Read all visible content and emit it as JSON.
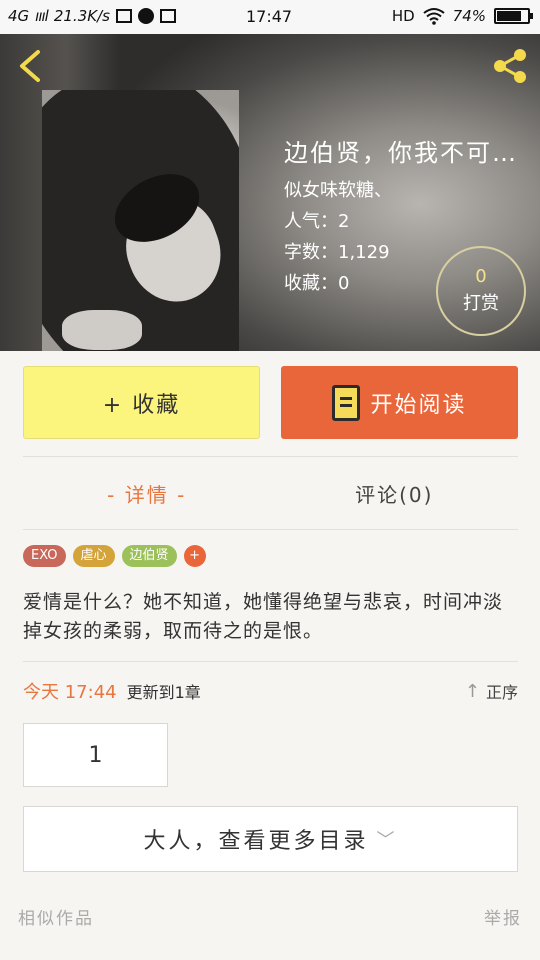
{
  "status_bar": {
    "network": "4G",
    "speed": "21.3K/s",
    "time": "17:47",
    "hd": "HD",
    "battery_text": "74%",
    "battery_level": 0.74
  },
  "header": {
    "book_title": "边伯贤，你我不可…",
    "author": "似女味软糖、",
    "popularity": "人气：2",
    "word_count": "字数：1,129",
    "favorites": "收藏：0",
    "reward_count": "0",
    "reward_label": "打赏"
  },
  "actions": {
    "favorite_label": "+ 收藏",
    "read_label": "开始阅读"
  },
  "tabs": [
    {
      "label": "- 详情 -"
    },
    {
      "label": "评论(0)"
    }
  ],
  "tags": [
    {
      "label": "EXO",
      "color": "#c8685a"
    },
    {
      "label": "虐心",
      "color": "#d4a339"
    },
    {
      "label": "边伯贤",
      "color": "#9cc15a"
    },
    {
      "label": "+",
      "color": "#e9663a"
    }
  ],
  "synopsis": "爱情是什么？她不知道，她懂得绝望与悲哀，时间冲淡掉女孩的柔弱，取而待之的是恨。",
  "update": {
    "time": "今天 17:44",
    "text": "更新到1章",
    "sort_label": "正序"
  },
  "chapters": [
    "1"
  ],
  "more_catalog": "大人，查看更多目录",
  "footer": {
    "similar": "相似作品",
    "report": "举报"
  },
  "colors": {
    "accent": "#e9663a",
    "favorite_bg": "#fbf57e",
    "icon_yellow": "#f3d94c"
  }
}
